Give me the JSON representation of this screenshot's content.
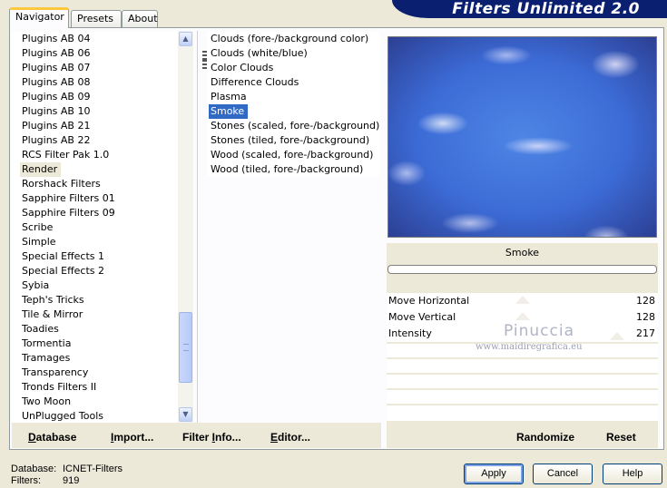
{
  "tabs": [
    "Navigator",
    "Presets",
    "About"
  ],
  "banner_title": "Filters Unlimited 2.0",
  "categories": {
    "items": [
      "Plugins AB 04",
      "Plugins AB 06",
      "Plugins AB 07",
      "Plugins AB 08",
      "Plugins AB 09",
      "Plugins AB 10",
      "Plugins AB 21",
      "Plugins AB 22",
      "RCS Filter Pak 1.0",
      "Render",
      "Rorshack Filters",
      "Sapphire Filters 01",
      "Sapphire Filters 09",
      "Scribe",
      "Simple",
      "Special Effects 1",
      "Special Effects 2",
      "Sybia",
      "Teph's Tricks",
      "Tile & Mirror",
      "Toadies",
      "Tormentia",
      "Tramages",
      "Transparency",
      "Tronds Filters II",
      "Two Moon",
      "UnPlugged Tools"
    ],
    "selected": "Render"
  },
  "filters": {
    "items": [
      "Clouds (fore-/background color)",
      "Clouds (white/blue)",
      "Color Clouds",
      "Difference Clouds",
      "Plasma",
      "Smoke",
      "Stones (scaled, fore-/background)",
      "Stones (tiled, fore-/background)",
      "Wood (scaled, fore-/background)",
      "Wood (tiled, fore-/background)"
    ],
    "selected": "Smoke"
  },
  "preview": {
    "filter_name": "Smoke",
    "colors": {
      "sky": "#3c6bd6",
      "cloud": "#e8e6f4"
    }
  },
  "params": [
    {
      "label": "Move Horizontal",
      "value": "128"
    },
    {
      "label": "Move Vertical",
      "value": "128"
    },
    {
      "label": "Intensity",
      "value": "217"
    }
  ],
  "watermark": {
    "title": "Pinuccia",
    "url": "www.maidiregrafica.eu"
  },
  "toolbar": {
    "database": {
      "pre": "",
      "u": "D",
      "post": "atabase"
    },
    "import": {
      "pre": "",
      "u": "I",
      "post": "mport..."
    },
    "filter_info": {
      "pre": "Filter ",
      "u": "I",
      "post": "nfo..."
    },
    "editor": {
      "pre": "",
      "u": "E",
      "post": "ditor..."
    },
    "randomize": "Randomize",
    "reset": "Reset"
  },
  "footer": {
    "database_label": "Database:",
    "database_value": "ICNET-Filters",
    "filters_label": "Filters:",
    "filters_value": "919",
    "apply": "Apply",
    "cancel": "Cancel",
    "help": "Help"
  },
  "icons": {
    "scroll_up": "chevron-up-icon",
    "scroll_down": "chevron-down-icon"
  }
}
